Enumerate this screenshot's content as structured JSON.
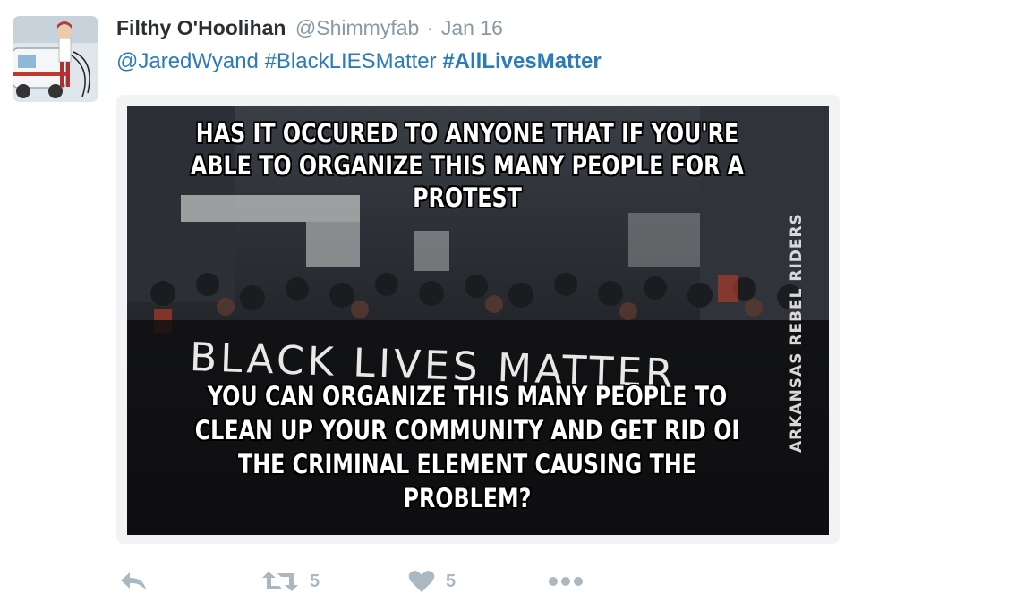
{
  "tweet": {
    "author_name": "Filthy O'Hoolihan",
    "handle": "@Shimmyfab",
    "separator": "·",
    "date": "Jan 16",
    "mention": "@JaredWyand",
    "hashtag1": "#BlackLIESMatter",
    "hashtag2": "#AllLivesMatter",
    "image": {
      "top_lines": [
        "HAS IT OCCURED TO ANYONE THAT IF YOU'RE",
        "ABLE TO ORGANIZE THIS MANY PEOPLE FOR A",
        "PROTEST"
      ],
      "banner": "BLACK LIVES MATTER",
      "bottom_lines": [
        "YOU CAN ORGANIZE THIS MANY PEOPLE TO",
        "CLEAN UP YOUR COMMUNITY AND GET RID OI",
        "THE CRIMINAL ELEMENT CAUSING THE",
        "PROBLEM?"
      ],
      "side_text": "ARKANSAS REBEL RIDERS"
    },
    "actions": {
      "retweet_count": "5",
      "like_count": "5"
    }
  },
  "icons": [
    "reply-icon",
    "retweet-icon",
    "heart-icon",
    "more-icon"
  ],
  "colors": {
    "link": "#2b7bb9",
    "muted": "#8899a6",
    "action": "#aab8c2",
    "name": "#292f33"
  }
}
